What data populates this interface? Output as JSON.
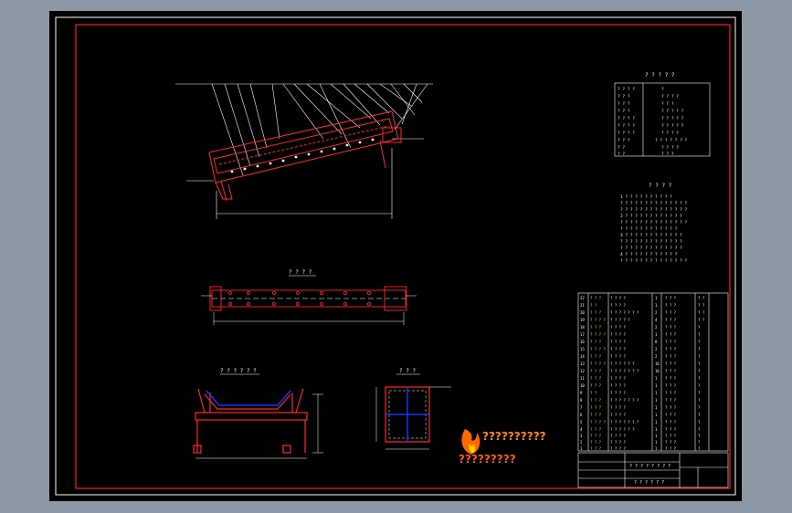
{
  "titles": {
    "top_view": "? ? ? ?",
    "rollers_view": "? ? ? ? ? ?",
    "section_view": "? ? ?"
  },
  "tech_params": {
    "heading": "? ? ? ? ?",
    "rows": [
      {
        "name": "? ? ? ?",
        "value": "?"
      },
      {
        "name": "? ? ?",
        "value": "? ? ? ?"
      },
      {
        "name": "? ? ?",
        "value": "? ? ?"
      },
      {
        "name": "? ? ?",
        "value": "? ? ? ? ?"
      },
      {
        "name": "? ? ? ?",
        "value": "? ? ? ? ?"
      },
      {
        "name": "? ? ? ?",
        "value": "? ? ? ? ?"
      },
      {
        "name": "? ? ? ?",
        "value": "? ? ? ?"
      },
      {
        "name": "? ? ?",
        "value": "? ? ? ? ? ? ?"
      },
      {
        "name": "? ?",
        "value": "? ? ? ?"
      },
      {
        "name": "? ?",
        "value": "? ? ?"
      }
    ]
  },
  "tech_requirements": {
    "heading": "? ? ? ?",
    "lines": [
      "1 ? ? ? ? ? ? ? ? ? ?",
      "? ? ? ? ? ? ? ? ? ? ? ? ? ?",
      "? ? ? ? ? ? ? ? ? ? ? ? ? ?",
      "2 ? ? ? ? ? ? ? ? ? ? ? ?",
      "? ? ? ? ? ? ? ? ? ? ? ? ? ?",
      "? ? ? ? ? ? ? ? ? ? ? ?",
      "3 ? ? ? ? ? ? ? ? ? ? ? ?",
      "? ? ? ? ? ? ? ? ? ? ? ? ?",
      "? ? ? ? ? ? ? ? ? ? ? ? ?",
      "4 ? ? ? ? ? ? ? ? ? ? ?",
      "? ? ? ? ? ? ? ? ? ? ? ? ? ?"
    ]
  },
  "parts_list": {
    "rows": [
      {
        "no": "22",
        "code": "? ? ?",
        "name": "? ? ? ?",
        "qty": "1",
        "mat": "? ? ?",
        "note": "? ?"
      },
      {
        "no": "21",
        "code": "? ?",
        "name": "? ? ? ?",
        "qty": "1",
        "mat": "? ? ?",
        "note": "? ?"
      },
      {
        "no": "20",
        "code": "? ? ?",
        "name": "? ? ? ? ? ? ?",
        "qty": "2",
        "mat": "? ? ?",
        "note": "? ?"
      },
      {
        "no": "19",
        "code": "? ? ? ?",
        "name": "? ? ? ? ?",
        "qty": "4",
        "mat": "? ? ?",
        "note": "? ?"
      },
      {
        "no": "18",
        "code": "? ? ?",
        "name": "? ? ? ?",
        "qty": "2",
        "mat": "? ? ?",
        "note": "?"
      },
      {
        "no": "17",
        "code": "? ? ? ?",
        "name": "? ? ? ?",
        "qty": "1",
        "mat": "? ? ?",
        "note": "?"
      },
      {
        "no": "16",
        "code": "? ? ?",
        "name": "? ? ? ?",
        "qty": "8",
        "mat": "? ? ?",
        "note": "?"
      },
      {
        "no": "15",
        "code": "? ? ? ?",
        "name": "? ? ? ?",
        "qty": "2",
        "mat": "? ? ?",
        "note": "?"
      },
      {
        "no": "14",
        "code": "? ? ?",
        "name": "? ? ? ?",
        "qty": "2",
        "mat": "? ? ?",
        "note": "?"
      },
      {
        "no": "13",
        "code": "? ? ? ?",
        "name": "? ? ? ? ? ?",
        "qty": "16",
        "mat": "? ? ?",
        "note": "?"
      },
      {
        "no": "12",
        "code": "? ? ?",
        "name": "? ? ? ? ? ? ?",
        "qty": "16",
        "mat": "? ? ?",
        "note": "?"
      },
      {
        "no": "11",
        "code": "? ? ?",
        "name": "? ? ? ?",
        "qty": "1",
        "mat": "? ? ?",
        "note": "?"
      },
      {
        "no": "10",
        "code": "? ? ?",
        "name": "? ? ? ?",
        "qty": "1",
        "mat": "? ? ?",
        "note": "?"
      },
      {
        "no": "9",
        "code": "? ?",
        "name": "? ? ? ?",
        "qty": "1",
        "mat": "? ? ?",
        "note": "?"
      },
      {
        "no": "8",
        "code": "? ? ?",
        "name": "? ? ? ? ? ? ?",
        "qty": "1",
        "mat": "? ? ?",
        "note": "?"
      },
      {
        "no": "7",
        "code": "? ? ?",
        "name": "? ? ? ?",
        "qty": "1",
        "mat": "? ? ?",
        "note": "?"
      },
      {
        "no": "6",
        "code": "? ? ?",
        "name": "? ? ? ?",
        "qty": "1",
        "mat": "? ? ?",
        "note": "?"
      },
      {
        "no": "5",
        "code": "? ? ? ?",
        "name": "? ? ? ? ? ? ?",
        "qty": "1",
        "mat": "? ? ?",
        "note": "?"
      },
      {
        "no": "4",
        "code": "? ? ?",
        "name": "? ? ? ? ? ?",
        "qty": "1",
        "mat": "? ? ?",
        "note": "?"
      },
      {
        "no": "3",
        "code": "? ? ?",
        "name": "? ? ? ?",
        "qty": "1",
        "mat": "? ? ?",
        "note": "?"
      },
      {
        "no": "2",
        "code": "? ? ?",
        "name": "? ? ? ?",
        "qty": "1",
        "mat": "? ? ?",
        "note": "?"
      },
      {
        "no": "1",
        "code": "? ? ?",
        "name": "? ? ? ?",
        "qty": "1",
        "mat": "? ? ?",
        "note": "?"
      }
    ]
  },
  "title_block": {
    "drawing_title": "? ? ? ? ? ? ? ?",
    "school": "? ? ? ? ? ?"
  },
  "watermark": {
    "line1": "??????????",
    "line2": "?????????"
  },
  "colors": {
    "frame": "#ff1e1e",
    "structure": "#ff2a2a",
    "annotation": "#ffffff",
    "section_fill": "#2233ff",
    "flame": "#ff6a00"
  }
}
